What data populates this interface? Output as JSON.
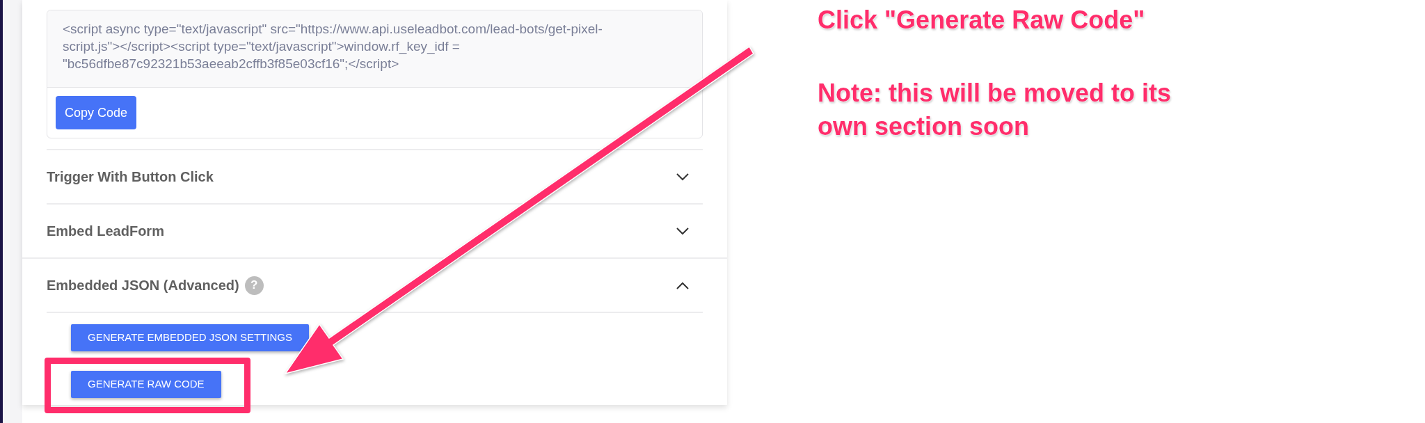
{
  "code_box": {
    "code": "<script async type=\"text/javascript\" src=\"https://www.api.useleadbot.com/lead-bots/get-pixel-script.js\"></script><script type=\"text/javascript\">window.rf_key_idf = \"bc56dfbe87c92321b53aeeab2cffb3f85e03cf16\";</script>",
    "button": "Copy Code"
  },
  "sections": [
    {
      "title": "Trigger With Button Click",
      "expanded": false
    },
    {
      "title": "Embed LeadForm",
      "expanded": false
    },
    {
      "title": "Embedded JSON (Advanced)",
      "expanded": true,
      "help_mark": "?"
    }
  ],
  "actions": [
    {
      "label": "GENERATE EMBEDDED JSON SETTINGS",
      "highlighted": false
    },
    {
      "label": "GENERATE RAW CODE",
      "highlighted": true
    }
  ],
  "annotation": {
    "heading": "Click \"Generate Raw Code\"",
    "note": "Note: this will be moved to its own section soon"
  }
}
